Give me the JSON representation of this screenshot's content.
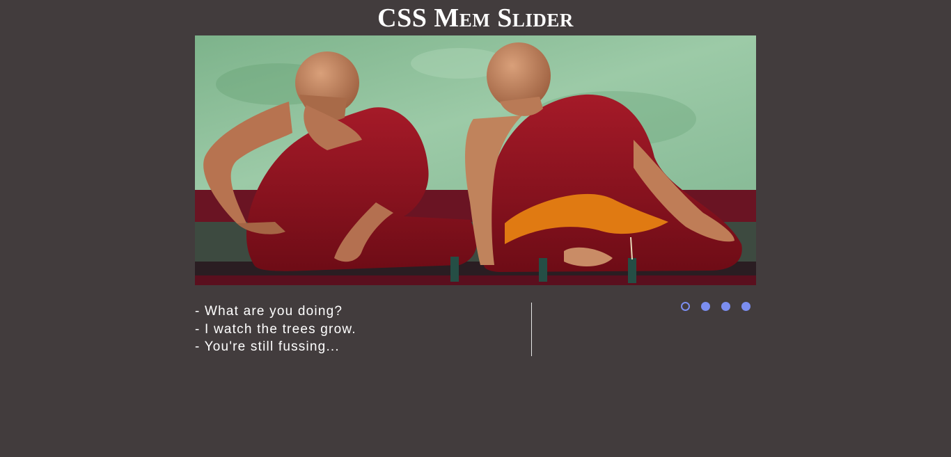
{
  "page": {
    "title": "CSS Mem Slider"
  },
  "slider": {
    "image_icon": "monks-sitting-image",
    "caption_lines": [
      "- What are you doing?",
      "- I watch the trees grow.",
      "- You're still fussing..."
    ],
    "dots_total": 4,
    "active_dot": 1
  },
  "colors": {
    "background": "#423c3d",
    "text": "#ffffff",
    "dot_accent": "#7b8ef0",
    "robe": "#8e1320",
    "wall": "#8dbf9a"
  }
}
